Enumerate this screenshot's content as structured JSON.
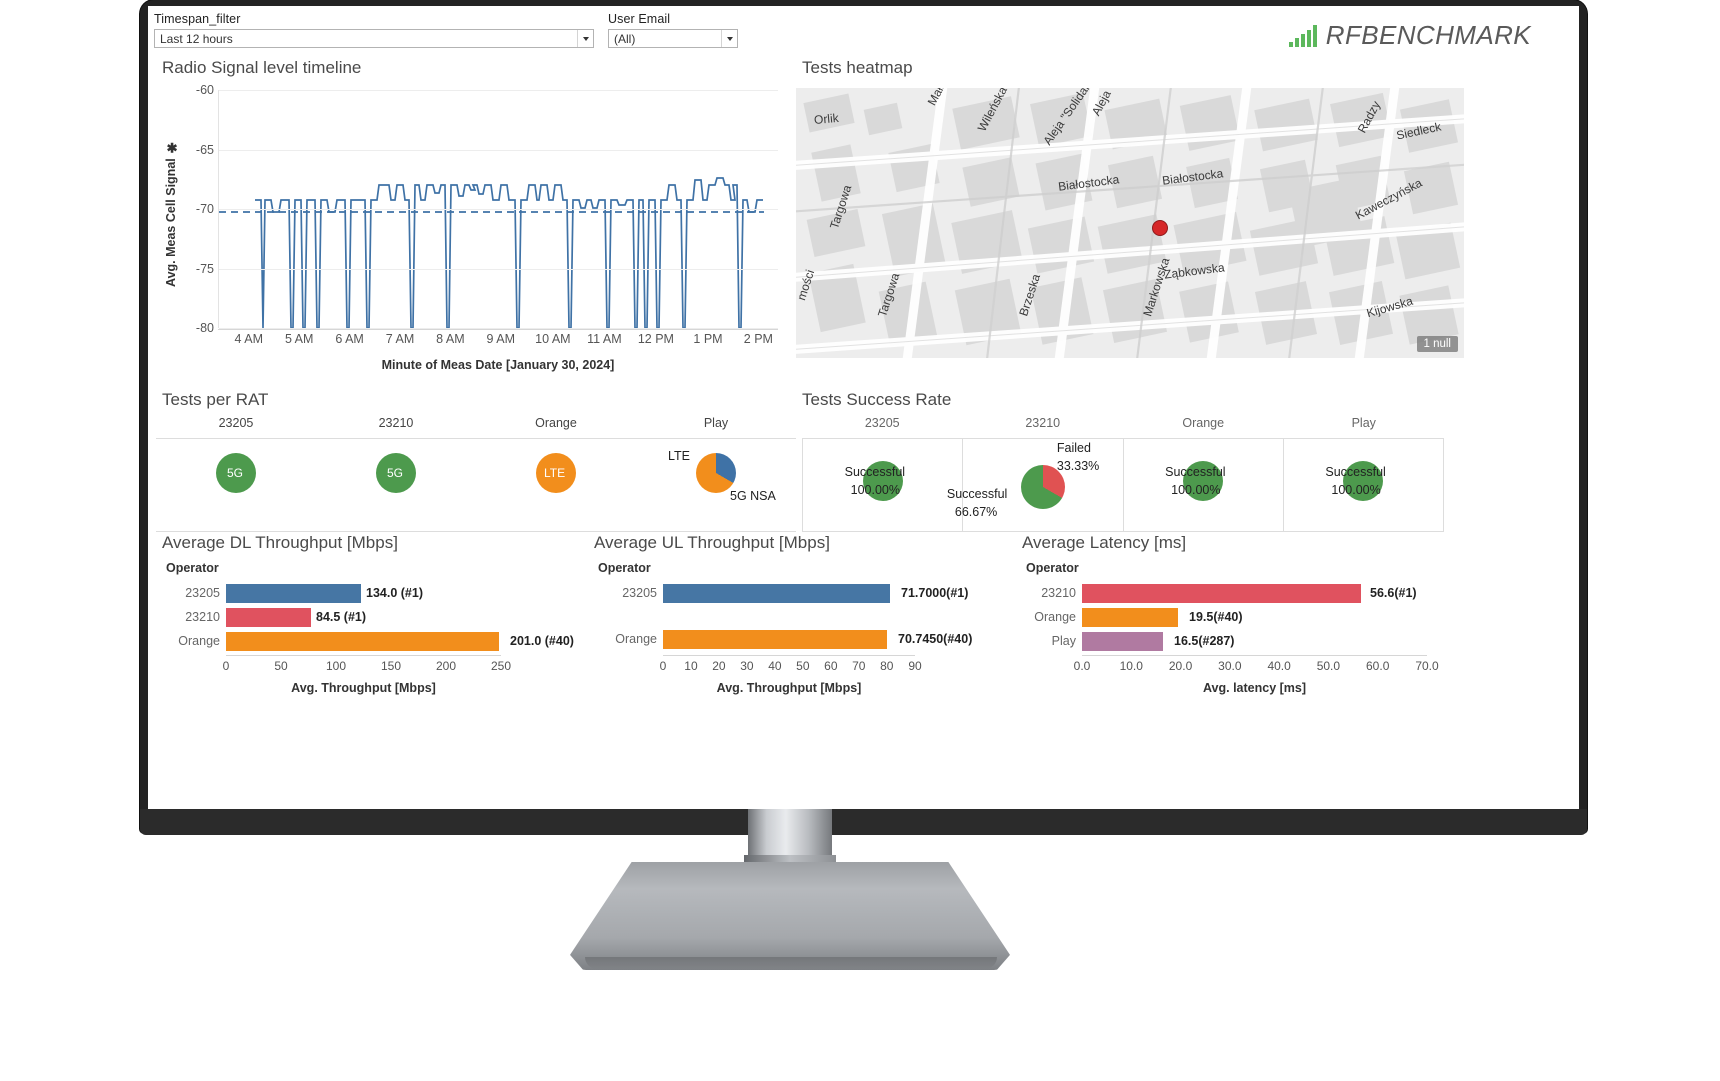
{
  "brand": {
    "name": "RFBENCHMARK",
    "logo_icon": "signal-bars-icon",
    "logo_color": "#5cb85c"
  },
  "filters": [
    {
      "label": "Timespan_filter",
      "value": "Last 12 hours",
      "name": "timespan-filter"
    },
    {
      "label": "User Email",
      "value": "(All)",
      "name": "user-email-filter"
    }
  ],
  "panels": {
    "timeline_title": "Radio Signal level timeline",
    "heatmap_title": "Tests heatmap",
    "rat_title": "Tests per RAT",
    "success_title": "Tests Success Rate",
    "dl_title": "Average DL Throughput [Mbps]",
    "ul_title": "Average UL Throughput [Mbps]",
    "lat_title": "Average Latency [ms]"
  },
  "map": {
    "null_badge": "1 null",
    "labels": [
      "Orlik",
      "Wileńska",
      "Aleja \"Solidarności\"",
      "Aleja",
      "Targowa",
      "Białostocka",
      "Białostocka",
      "Radzy",
      "Siedleck",
      "Kaweczyńska",
      "Ząbkowska",
      "Targowa",
      "Brzeska",
      "Markowska",
      "Kijowska",
      "mości"
    ]
  },
  "chart_data": [
    {
      "type": "line",
      "name": "radio-signal-timeline",
      "title": "Radio Signal level timeline",
      "ylabel": "Avg. Meas Cell Signal",
      "xlabel": "Minute of Meas Date [January 30, 2024]",
      "ylim": [
        -81,
        -59
      ],
      "yticks": [
        -60,
        -65,
        -70,
        -75,
        -80
      ],
      "xticks": [
        "4 AM",
        "5 AM",
        "6 AM",
        "7 AM",
        "8 AM",
        "9 AM",
        "10 AM",
        "11 AM",
        "12 PM",
        "1 PM",
        "2 PM"
      ],
      "reference_line": -71.3,
      "series_color": "#3f72a6",
      "grid": true
    },
    {
      "type": "pie",
      "name": "tests-per-rat",
      "title": "Tests per RAT",
      "categories": [
        "23205",
        "23210",
        "Orange",
        "Play"
      ],
      "pies": [
        {
          "operator": "23205",
          "slices": [
            {
              "label": "5G",
              "value": 100,
              "color": "#4d9a4d"
            }
          ]
        },
        {
          "operator": "23210",
          "slices": [
            {
              "label": "5G",
              "value": 100,
              "color": "#4d9a4d"
            }
          ]
        },
        {
          "operator": "Orange",
          "slices": [
            {
              "label": "LTE",
              "value": 100,
              "color": "#f28e1c"
            }
          ]
        },
        {
          "operator": "Play",
          "slices": [
            {
              "label": "LTE",
              "value": 66.7,
              "color": "#f28e1c"
            },
            {
              "label": "5G NSA",
              "value": 33.3,
              "color": "#3f72a6"
            }
          ]
        }
      ]
    },
    {
      "type": "pie",
      "name": "tests-success-rate",
      "title": "Tests Success Rate",
      "categories": [
        "23205",
        "23210",
        "Orange",
        "Play"
      ],
      "pies": [
        {
          "operator": "23205",
          "slices": [
            {
              "label": "Successful",
              "pct": "100.00%",
              "value": 100,
              "color": "#4d9a4d"
            }
          ]
        },
        {
          "operator": "23210",
          "slices": [
            {
              "label": "Successful",
              "pct": "66.67%",
              "value": 66.67,
              "color": "#4d9a4d"
            },
            {
              "label": "Failed",
              "pct": "33.33%",
              "value": 33.33,
              "color": "#e05252"
            }
          ]
        },
        {
          "operator": "Orange",
          "slices": [
            {
              "label": "Successful",
              "pct": "100.00%",
              "value": 100,
              "color": "#4d9a4d"
            }
          ]
        },
        {
          "operator": "Play",
          "slices": [
            {
              "label": "Successful",
              "pct": "100.00%",
              "value": 100,
              "color": "#4d9a4d"
            }
          ]
        }
      ]
    },
    {
      "type": "bar",
      "name": "average-dl-throughput",
      "title": "Average DL Throughput [Mbps]",
      "legend_title": "Operator",
      "xlabel": "Avg. Throughput [Mbps]",
      "categories": [
        "23205",
        "23210",
        "Orange"
      ],
      "values": [
        134.0,
        84.5,
        201.0
      ],
      "labels": [
        "134.0 (#1)",
        "84.5 (#1)",
        "201.0 (#40)"
      ],
      "colors": [
        "#4676a4",
        "#e0525f",
        "#f28e1c"
      ],
      "xticks": [
        0,
        50,
        100,
        150,
        200,
        250
      ],
      "xlim": [
        0,
        250
      ]
    },
    {
      "type": "bar",
      "name": "average-ul-throughput",
      "title": "Average UL Throughput [Mbps]",
      "legend_title": "Operator",
      "xlabel": "Avg. Throughput [Mbps]",
      "categories": [
        "23205",
        "Orange"
      ],
      "values": [
        71.7,
        70.745
      ],
      "labels": [
        "71.7000(#1)",
        "70.7450(#40)"
      ],
      "colors": [
        "#4676a4",
        "#f28e1c"
      ],
      "xticks": [
        0,
        10,
        20,
        30,
        40,
        50,
        60,
        70,
        80,
        90
      ],
      "xlim": [
        0,
        90
      ]
    },
    {
      "type": "bar",
      "name": "average-latency",
      "title": "Average Latency [ms]",
      "legend_title": "Operator",
      "xlabel": "Avg. latency [ms]",
      "categories": [
        "23210",
        "Orange",
        "Play"
      ],
      "values": [
        56.6,
        19.5,
        16.5
      ],
      "labels": [
        "56.6(#1)",
        "19.5(#40)",
        "16.5(#287)"
      ],
      "colors": [
        "#e0525f",
        "#f28e1c",
        "#b07aa1"
      ],
      "xticks": [
        "0.0",
        "10.0",
        "20.0",
        "30.0",
        "40.0",
        "50.0",
        "60.0",
        "70.0"
      ],
      "xlim": [
        0,
        70
      ]
    }
  ]
}
